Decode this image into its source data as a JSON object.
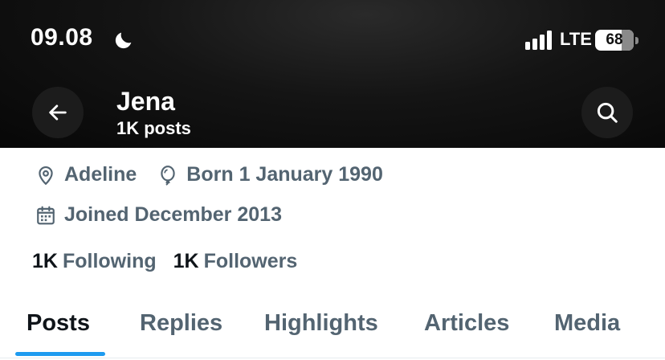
{
  "status_bar": {
    "time": "09.08",
    "network": "LTE",
    "battery": "68",
    "battery_level": 0.68,
    "icons": [
      "moon-icon",
      "signal-icon",
      "battery-icon"
    ]
  },
  "header": {
    "name": "Jena",
    "post_count": "1K posts",
    "icons": [
      "back-arrow-icon",
      "search-icon"
    ]
  },
  "profile": {
    "location": "Adeline",
    "birthday": "Born 1 January 1990",
    "joined": "Joined December 2013",
    "following_count": "1K",
    "following_label": "Following",
    "followers_count": "1K",
    "followers_label": "Followers"
  },
  "tabs": [
    {
      "label": "Posts",
      "active": true
    },
    {
      "label": "Replies",
      "active": false
    },
    {
      "label": "Highlights",
      "active": false
    },
    {
      "label": "Articles",
      "active": false
    },
    {
      "label": "Media",
      "active": false
    }
  ],
  "colors": {
    "header_bg": "#0a0a0a",
    "text_primary": "#0f1419",
    "text_secondary": "#536471",
    "accent": "#1d9bf0"
  }
}
